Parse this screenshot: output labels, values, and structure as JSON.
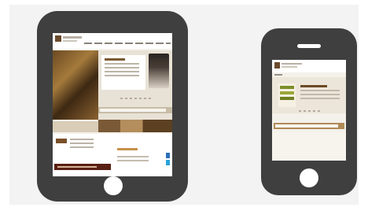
{
  "devices": [
    {
      "kind": "tablet",
      "icon": "tablet-icon"
    },
    {
      "kind": "phone",
      "icon": "smartphone-icon"
    }
  ],
  "colors": {
    "device_body": "#3f3f3f",
    "background": "#f3f3f3",
    "accent_brown": "#7a5a32",
    "accent_green": "#7a8f2a"
  }
}
